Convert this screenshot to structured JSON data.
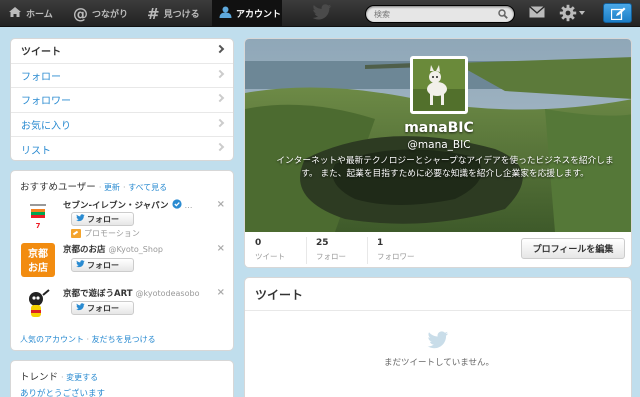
{
  "topnav": {
    "home": "ホーム",
    "connect": "つながり",
    "discover": "見つける",
    "account": "アカウント",
    "search_placeholder": "検索"
  },
  "leftnav": {
    "items": [
      "ツイート",
      "フォロー",
      "フォロワー",
      "お気に入り",
      "リスト"
    ]
  },
  "suggestions": {
    "title": "おすすめユーザー",
    "refresh": "更新",
    "view_all": "すべて見る",
    "follow_label": "フォロー",
    "users": [
      {
        "name": "セブン-イレブン・ジャパン",
        "screen_name": "",
        "promotion": "プロモーション",
        "verified": true
      },
      {
        "name": "京都のお店",
        "screen_name": "@Kyoto_Shop"
      },
      {
        "name": "京都で遊ぼうART",
        "screen_name": "@kyotodeasobo"
      }
    ],
    "footer_popular": "人気のアカウント",
    "footer_find": "友だちを見つける"
  },
  "trends": {
    "title": "トレンド",
    "change": "変更する",
    "items": [
      "ありがとうございます"
    ]
  },
  "profile": {
    "name": "manaBIC",
    "handle": "@mana_BIC",
    "bio": "インターネットや最新テクノロジーとシャープなアイデアを使ったビジネスを紹介します。 また、起業を目指すために必要な知識を紹介し企業家を応援します。",
    "stats": [
      {
        "value": "0",
        "label": "ツイート"
      },
      {
        "value": "25",
        "label": "フォロー"
      },
      {
        "value": "1",
        "label": "フォロワー"
      }
    ],
    "edit_button": "プロフィールを編集"
  },
  "tweets": {
    "title": "ツイート",
    "empty_message": "まだツイートしていません。"
  },
  "colors": {
    "link": "#2a8bd1",
    "topbar": "#2b2b2b",
    "background": "#c0deed",
    "compose": "#2a8bd1"
  }
}
